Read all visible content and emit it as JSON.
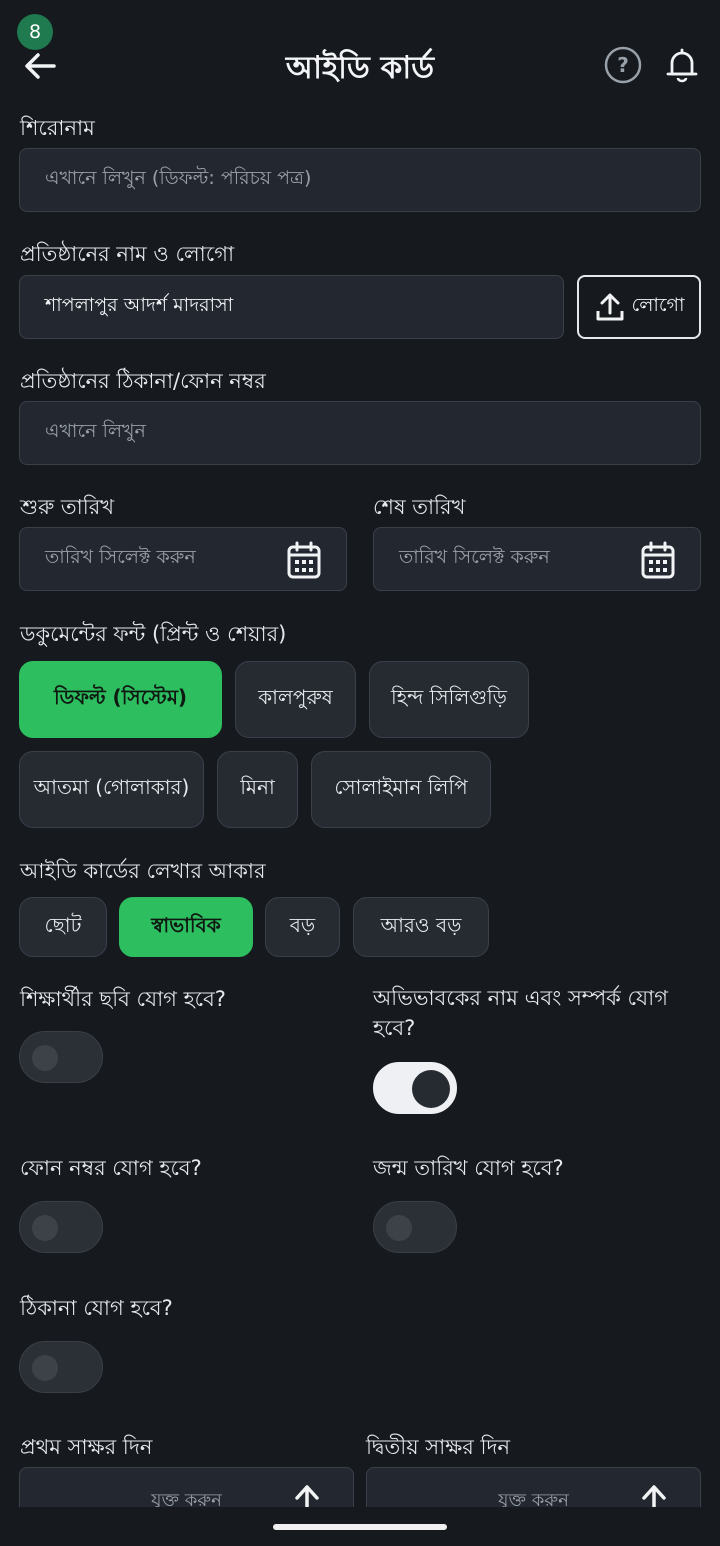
{
  "status": {
    "badge": "8"
  },
  "header": {
    "title": "আইডি কার্ড",
    "back_icon": "arrow-left-icon",
    "help_icon": "question-circle-icon",
    "bell_icon": "bell-icon"
  },
  "form": {
    "heading": {
      "label": "শিরোনাম",
      "placeholder": "এখানে লিখুন (ডিফল্ট: পরিচয় পত্র)"
    },
    "institution": {
      "label": "প্রতিষ্ঠানের নাম ও লোগো",
      "value": "শাপলাপুর আদর্শ মাদরাসা",
      "logo_button": "লোগো"
    },
    "address": {
      "label": "প্রতিষ্ঠানের ঠিকানা/ফোন নম্বর",
      "placeholder": "এখানে লিখুন"
    },
    "start_date": {
      "label": "শুরু তারিখ",
      "placeholder": "তারিখ সিলেক্ট করুন"
    },
    "end_date": {
      "label": "শেষ তারিখ",
      "placeholder": "তারিখ সিলেক্ট করুন"
    },
    "font": {
      "label": "ডকুমেন্টের ফন্ট (প্রিন্ট ও শেয়ার)",
      "options": [
        "ডিফল্ট (সিস্টেম)",
        "কালপুরুষ",
        "হিন্দ সিলিগুড়ি",
        "আতমা (গোলাকার)",
        "মিনা",
        "সোলাইমান লিপি"
      ],
      "selected": "ডিফল্ট (সিস্টেম)"
    },
    "text_size": {
      "label": "আইডি কার্ডের লেখার আকার",
      "options": [
        "ছোট",
        "স্বাভাবিক",
        "বড়",
        "আরও বড়"
      ],
      "selected": "স্বাভাবিক"
    },
    "toggles": {
      "student_photo": {
        "label": "শিক্ষার্থীর ছবি যোগ হবে?",
        "on": false
      },
      "guardian": {
        "label": "অভিভাবকের নাম এবং সম্পর্ক যোগ হবে?",
        "on": true
      },
      "phone": {
        "label": "ফোন নম্বর যোগ হবে?",
        "on": false
      },
      "birth_date": {
        "label": "জন্ম তারিখ যোগ হবে?",
        "on": false
      },
      "address": {
        "label": "ঠিকানা যোগ হবে?",
        "on": false
      }
    },
    "first_sign": {
      "label": "প্রথম সাক্ষর দিন",
      "button": "যুক্ত করুন"
    },
    "second_sign": {
      "label": "দ্বিতীয় সাক্ষর দিন",
      "button": "যুক্ত করুন"
    }
  },
  "colors": {
    "accent": "#2dbe5f",
    "background": "#161a1f",
    "field": "#232830"
  }
}
